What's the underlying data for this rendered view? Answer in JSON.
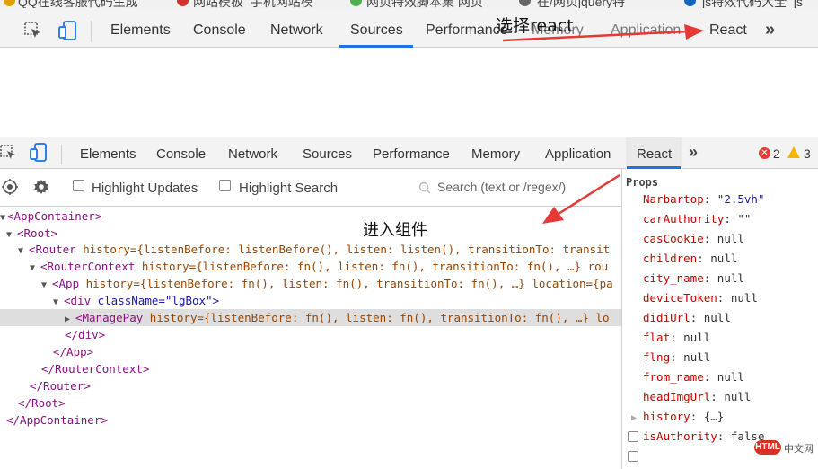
{
  "bookmarks": [
    {
      "label": "QQ在线客服代码生成",
      "color": "#e0a000"
    },
    {
      "label": "网站模板_手机网站模",
      "color": "#d32f2f"
    },
    {
      "label": "网页特效脚本集 网页",
      "color": "#4caf50"
    },
    {
      "label": "在/网页jquery特",
      "color": "#666666"
    },
    {
      "label": "js特效代码大全_js",
      "color": "#1565c0"
    }
  ],
  "devtools_top": {
    "tabs": [
      "Elements",
      "Console",
      "Network",
      "Sources",
      "Performance",
      "Memory",
      "Application",
      "React"
    ],
    "active_tab": "Sources",
    "more": "»"
  },
  "devtools_bottom": {
    "tabs": [
      "Elements",
      "Console",
      "Network",
      "Sources",
      "Performance",
      "Memory",
      "Application",
      "React"
    ],
    "active_tab": "React",
    "more": "»",
    "errors": "2",
    "warnings": "3"
  },
  "react_bar": {
    "highlight_updates": "Highlight Updates",
    "highlight_search": "Highlight Search",
    "search_placeholder": "Search (text or /regex/)"
  },
  "tree": [
    {
      "arrow": "▼",
      "tag": "<AppContainer>",
      "rest": ""
    },
    {
      "arrow": "▼",
      "tag": "<Root>",
      "rest": ""
    },
    {
      "arrow": "▼",
      "tag": "<Router",
      "rest": " history={listenBefore: listenBefore(), listen: listen(), transitionTo: transit"
    },
    {
      "arrow": "▼",
      "tag": "<RouterContext",
      "rest": " history={listenBefore: fn(), listen: fn(), transitionTo: fn(), …} rou"
    },
    {
      "arrow": "▼",
      "tag": "<App",
      "rest": " history={listenBefore: fn(), listen: fn(), transitionTo: fn(), …} location={pa"
    },
    {
      "arrow": "▼",
      "tag": "<div",
      "rest": " className=\"lgBox\">"
    },
    {
      "arrow": "▶",
      "tag": "<ManagePay",
      "rest": " history={listenBefore: fn(), listen: fn(), transitionTo: fn(), …} lo"
    },
    {
      "arrow": "",
      "tag": "</div>",
      "rest": ""
    },
    {
      "arrow": "",
      "tag": "</App>",
      "rest": ""
    },
    {
      "arrow": "",
      "tag": "</RouterContext>",
      "rest": ""
    },
    {
      "arrow": "",
      "tag": "</Router>",
      "rest": ""
    },
    {
      "arrow": "",
      "tag": "</Root>",
      "rest": ""
    },
    {
      "arrow": "",
      "tag": "</AppContainer>",
      "rest": ""
    }
  ],
  "props": {
    "header": "Props",
    "items": [
      {
        "key": "Narbartop",
        "value": "\"2.5vh\""
      },
      {
        "key": "carAuthority",
        "value": "\"\""
      },
      {
        "key": "casCookie",
        "value": "null"
      },
      {
        "key": "children",
        "value": "null"
      },
      {
        "key": "city_name",
        "value": "null"
      },
      {
        "key": "deviceToken",
        "value": "null"
      },
      {
        "key": "didiUrl",
        "value": "null"
      },
      {
        "key": "flat",
        "value": "null"
      },
      {
        "key": "flng",
        "value": "null"
      },
      {
        "key": "from_name",
        "value": "null"
      },
      {
        "key": "headImgUrl",
        "value": "null"
      },
      {
        "key": "history",
        "value": "{…}"
      },
      {
        "key": "isAuthority",
        "value": "false"
      }
    ]
  },
  "annotations": {
    "select_react": "选择react",
    "enter_component": "进入组件"
  },
  "watermark": {
    "badge": "HTML",
    "text": "中文网"
  },
  "colors": {
    "accent": "#1a73e8",
    "arrow_red": "#e53935"
  }
}
